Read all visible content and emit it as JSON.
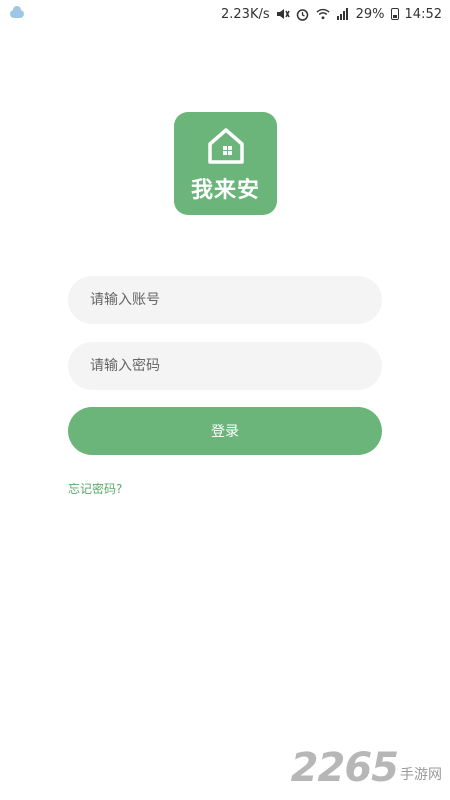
{
  "status_bar": {
    "speed": "2.23K/s",
    "battery": "29%",
    "time": "14:52",
    "icons": [
      "cloud-icon",
      "mute-icon",
      "alarm-icon",
      "wifi-icon",
      "signal-icon",
      "battery-icon"
    ]
  },
  "logo": {
    "text": "我来安",
    "icon": "house-icon",
    "color": "#6bb57a"
  },
  "login_form": {
    "account_placeholder": "请输入账号",
    "account_value": "",
    "password_placeholder": "请输入密码",
    "password_value": "",
    "login_label": "登录",
    "forgot_label": "忘记密码?"
  },
  "watermark": {
    "number": "2265",
    "text": "手游网"
  },
  "colors": {
    "accent": "#6bb57a",
    "field_bg": "#f4f4f4"
  }
}
